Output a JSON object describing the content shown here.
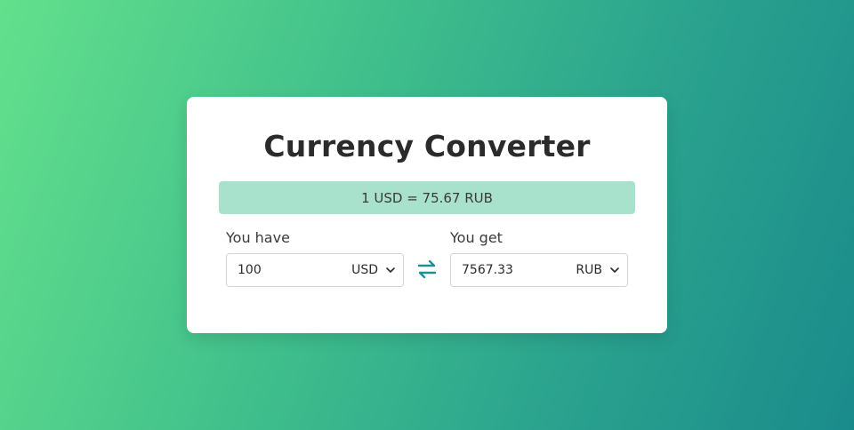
{
  "title": "Currency Converter",
  "rate_text": "1 USD = 75.67 RUB",
  "from": {
    "label": "You have",
    "amount": "100",
    "currency": "USD"
  },
  "to": {
    "label": "You get",
    "amount": "7567.33",
    "currency": "RUB"
  },
  "icons": {
    "swap": "swap-arrows-icon",
    "dropdown": "chevron-down-icon"
  },
  "colors": {
    "gradient_start": "#63e08c",
    "gradient_end": "#1a8b8b",
    "rate_bar_bg": "#a8e2cc",
    "accent": "#1f8f98"
  }
}
